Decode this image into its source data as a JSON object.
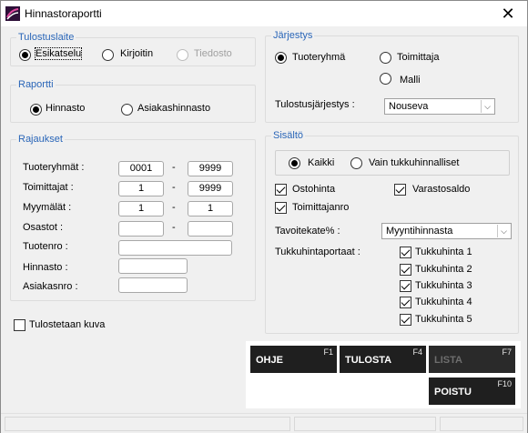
{
  "window": {
    "title": "Hinnastoraportti"
  },
  "output_device": {
    "legend": "Tulostuslaite",
    "options": [
      "Esikatselu",
      "Kirjoitin",
      "Tiedosto"
    ],
    "selected": "Esikatselu"
  },
  "report": {
    "legend": "Raportti",
    "options": [
      "Hinnasto",
      "Asiakashinnasto"
    ],
    "selected": "Hinnasto"
  },
  "limits": {
    "legend": "Rajaukset",
    "rows": [
      {
        "label": "Tuoteryhmät :",
        "from": "0001",
        "to": "9999"
      },
      {
        "label": "Toimittajat :",
        "from": "1",
        "to": "9999"
      },
      {
        "label": "Myymälät :",
        "from": "1",
        "to": "1"
      },
      {
        "label": "Osastot :",
        "from": "",
        "to": ""
      }
    ],
    "dash": "-",
    "singles": [
      {
        "label": "Tuotenro :",
        "value": ""
      },
      {
        "label": "Hinnasto :",
        "value": ""
      },
      {
        "label": "Asiakasnro :",
        "value": ""
      }
    ]
  },
  "print_image": {
    "label": "Tulostetaan kuva",
    "checked": false
  },
  "order": {
    "legend": "Järjestys",
    "options": [
      "Tuoteryhmä",
      "Toimittaja",
      "Malli"
    ],
    "selected": "Tuoteryhmä",
    "sort_label": "Tulostusjärjestys :",
    "sort_value": "Nouseva"
  },
  "content": {
    "legend": "Sisältö",
    "options": [
      "Kaikki",
      "Vain tukkuhinnalliset"
    ],
    "selected": "Kaikki",
    "checks": [
      {
        "label": "Ostohinta",
        "checked": true
      },
      {
        "label": "Varastosaldo",
        "checked": true
      },
      {
        "label": "Toimittajanro",
        "checked": true
      }
    ],
    "target_label": "Tavoitekate% :",
    "target_value": "Myyntihinnasta",
    "wholesale_label": "Tukkuhintaportaat :",
    "wholesale": [
      {
        "label": "Tukkuhinta 1",
        "checked": true
      },
      {
        "label": "Tukkuhinta 2",
        "checked": true
      },
      {
        "label": "Tukkuhinta 3",
        "checked": true
      },
      {
        "label": "Tukkuhinta 4",
        "checked": true
      },
      {
        "label": "Tukkuhinta 5",
        "checked": true
      }
    ]
  },
  "buttons": {
    "help": {
      "label": "OHJE",
      "key": "F1"
    },
    "print": {
      "label": "TULOSTA",
      "key": "F4"
    },
    "list": {
      "label": "LISTA",
      "key": "F7"
    },
    "exit": {
      "label": "POISTU",
      "key": "F10"
    }
  },
  "colors": {
    "legend": "#2a66b8",
    "button_bg": "#1f1f1f",
    "button_text": "#ffffff"
  },
  "icons": {
    "app": "app-logo-icon",
    "close": "close-icon"
  }
}
